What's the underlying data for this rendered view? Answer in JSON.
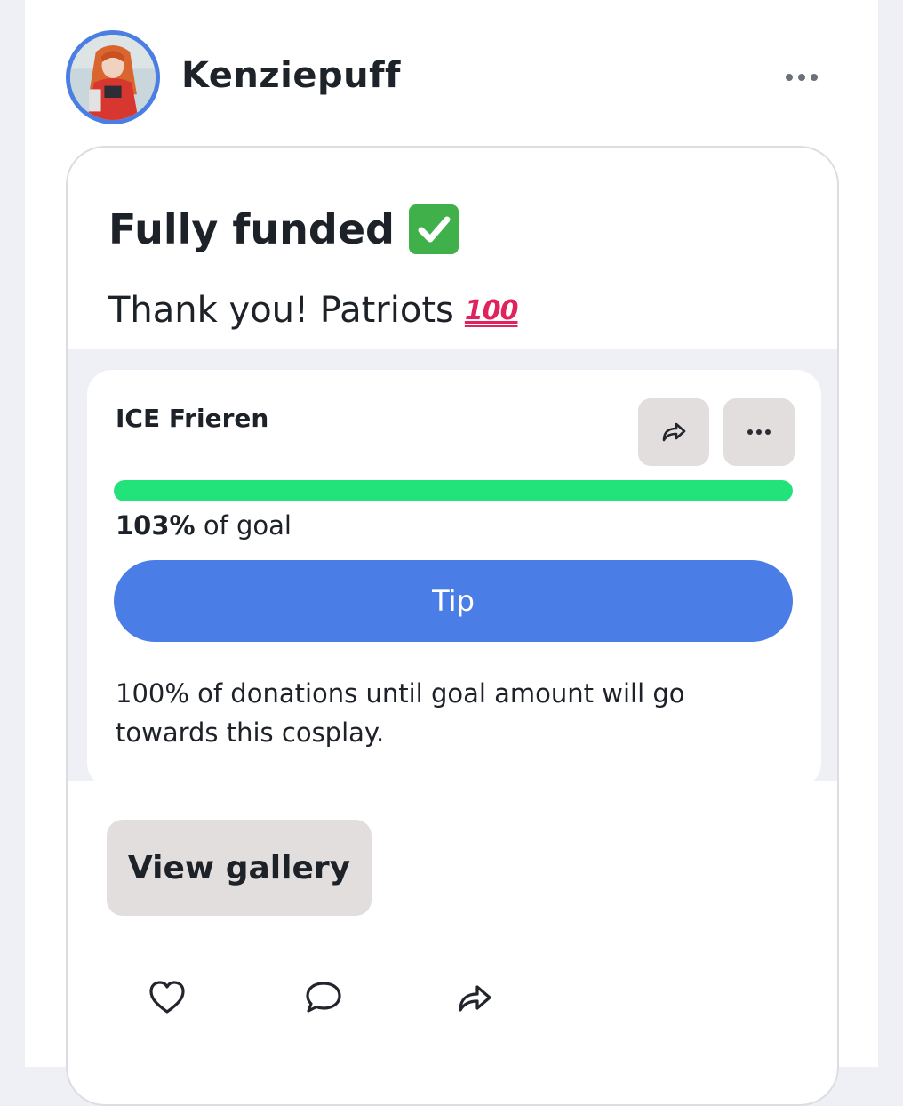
{
  "author": {
    "username": "Kenziepuff",
    "avatar_icon": "avatar"
  },
  "post": {
    "title": "Fully funded",
    "title_emoji": "white-check-mark",
    "body": "Thank you! Patriots",
    "body_emoji": "hundred-points"
  },
  "goal": {
    "name": "ICE Frieren",
    "progress_percent": 103,
    "progress_value": "103%",
    "progress_suffix": "of goal",
    "tip_label": "Tip",
    "note": "100% of donations until goal amount will go towards this cosplay."
  },
  "gallery_button_label": "View gallery",
  "colors": {
    "accent_blue": "#4a7ee6",
    "progress_green": "#22e27a",
    "button_gray": "#e2dede"
  },
  "actions": [
    "heart-icon",
    "comment-icon",
    "share-icon"
  ]
}
